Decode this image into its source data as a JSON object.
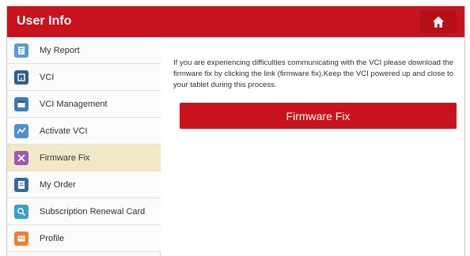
{
  "header": {
    "title": "User Info",
    "home_icon": "home-icon"
  },
  "sidebar": {
    "items": [
      {
        "label": "My Report",
        "icon": "report-icon",
        "color": "#5b9bd5"
      },
      {
        "label": "VCI",
        "icon": "vci-icon",
        "color": "#2f5f8f"
      },
      {
        "label": "VCI Management",
        "icon": "vci-management-icon",
        "color": "#3a7bbf"
      },
      {
        "label": "Activate VCI",
        "icon": "activate-vci-icon",
        "color": "#4a90d9"
      },
      {
        "label": "Firmware Fix",
        "icon": "tools-icon",
        "color": "#9b59b6"
      },
      {
        "label": "My Order",
        "icon": "order-icon",
        "color": "#2e6aa8"
      },
      {
        "label": "Subscription Renewal Card",
        "icon": "subscription-card-icon",
        "color": "#3aa0c9"
      },
      {
        "label": "Profile",
        "icon": "profile-icon",
        "color": "#f08030"
      }
    ],
    "active_item": "Firmware Fix"
  },
  "main": {
    "info_text": "If you are experiencing difficulties communicating with the VCI please download the firmware fix by clicking the link (firmware fix).Keep the VCI powered up and close to your tablet during this process.",
    "button_label": "Firmware Fix"
  },
  "colors": {
    "accent": "#c8121c",
    "active_bg": "#f3e8c6"
  }
}
